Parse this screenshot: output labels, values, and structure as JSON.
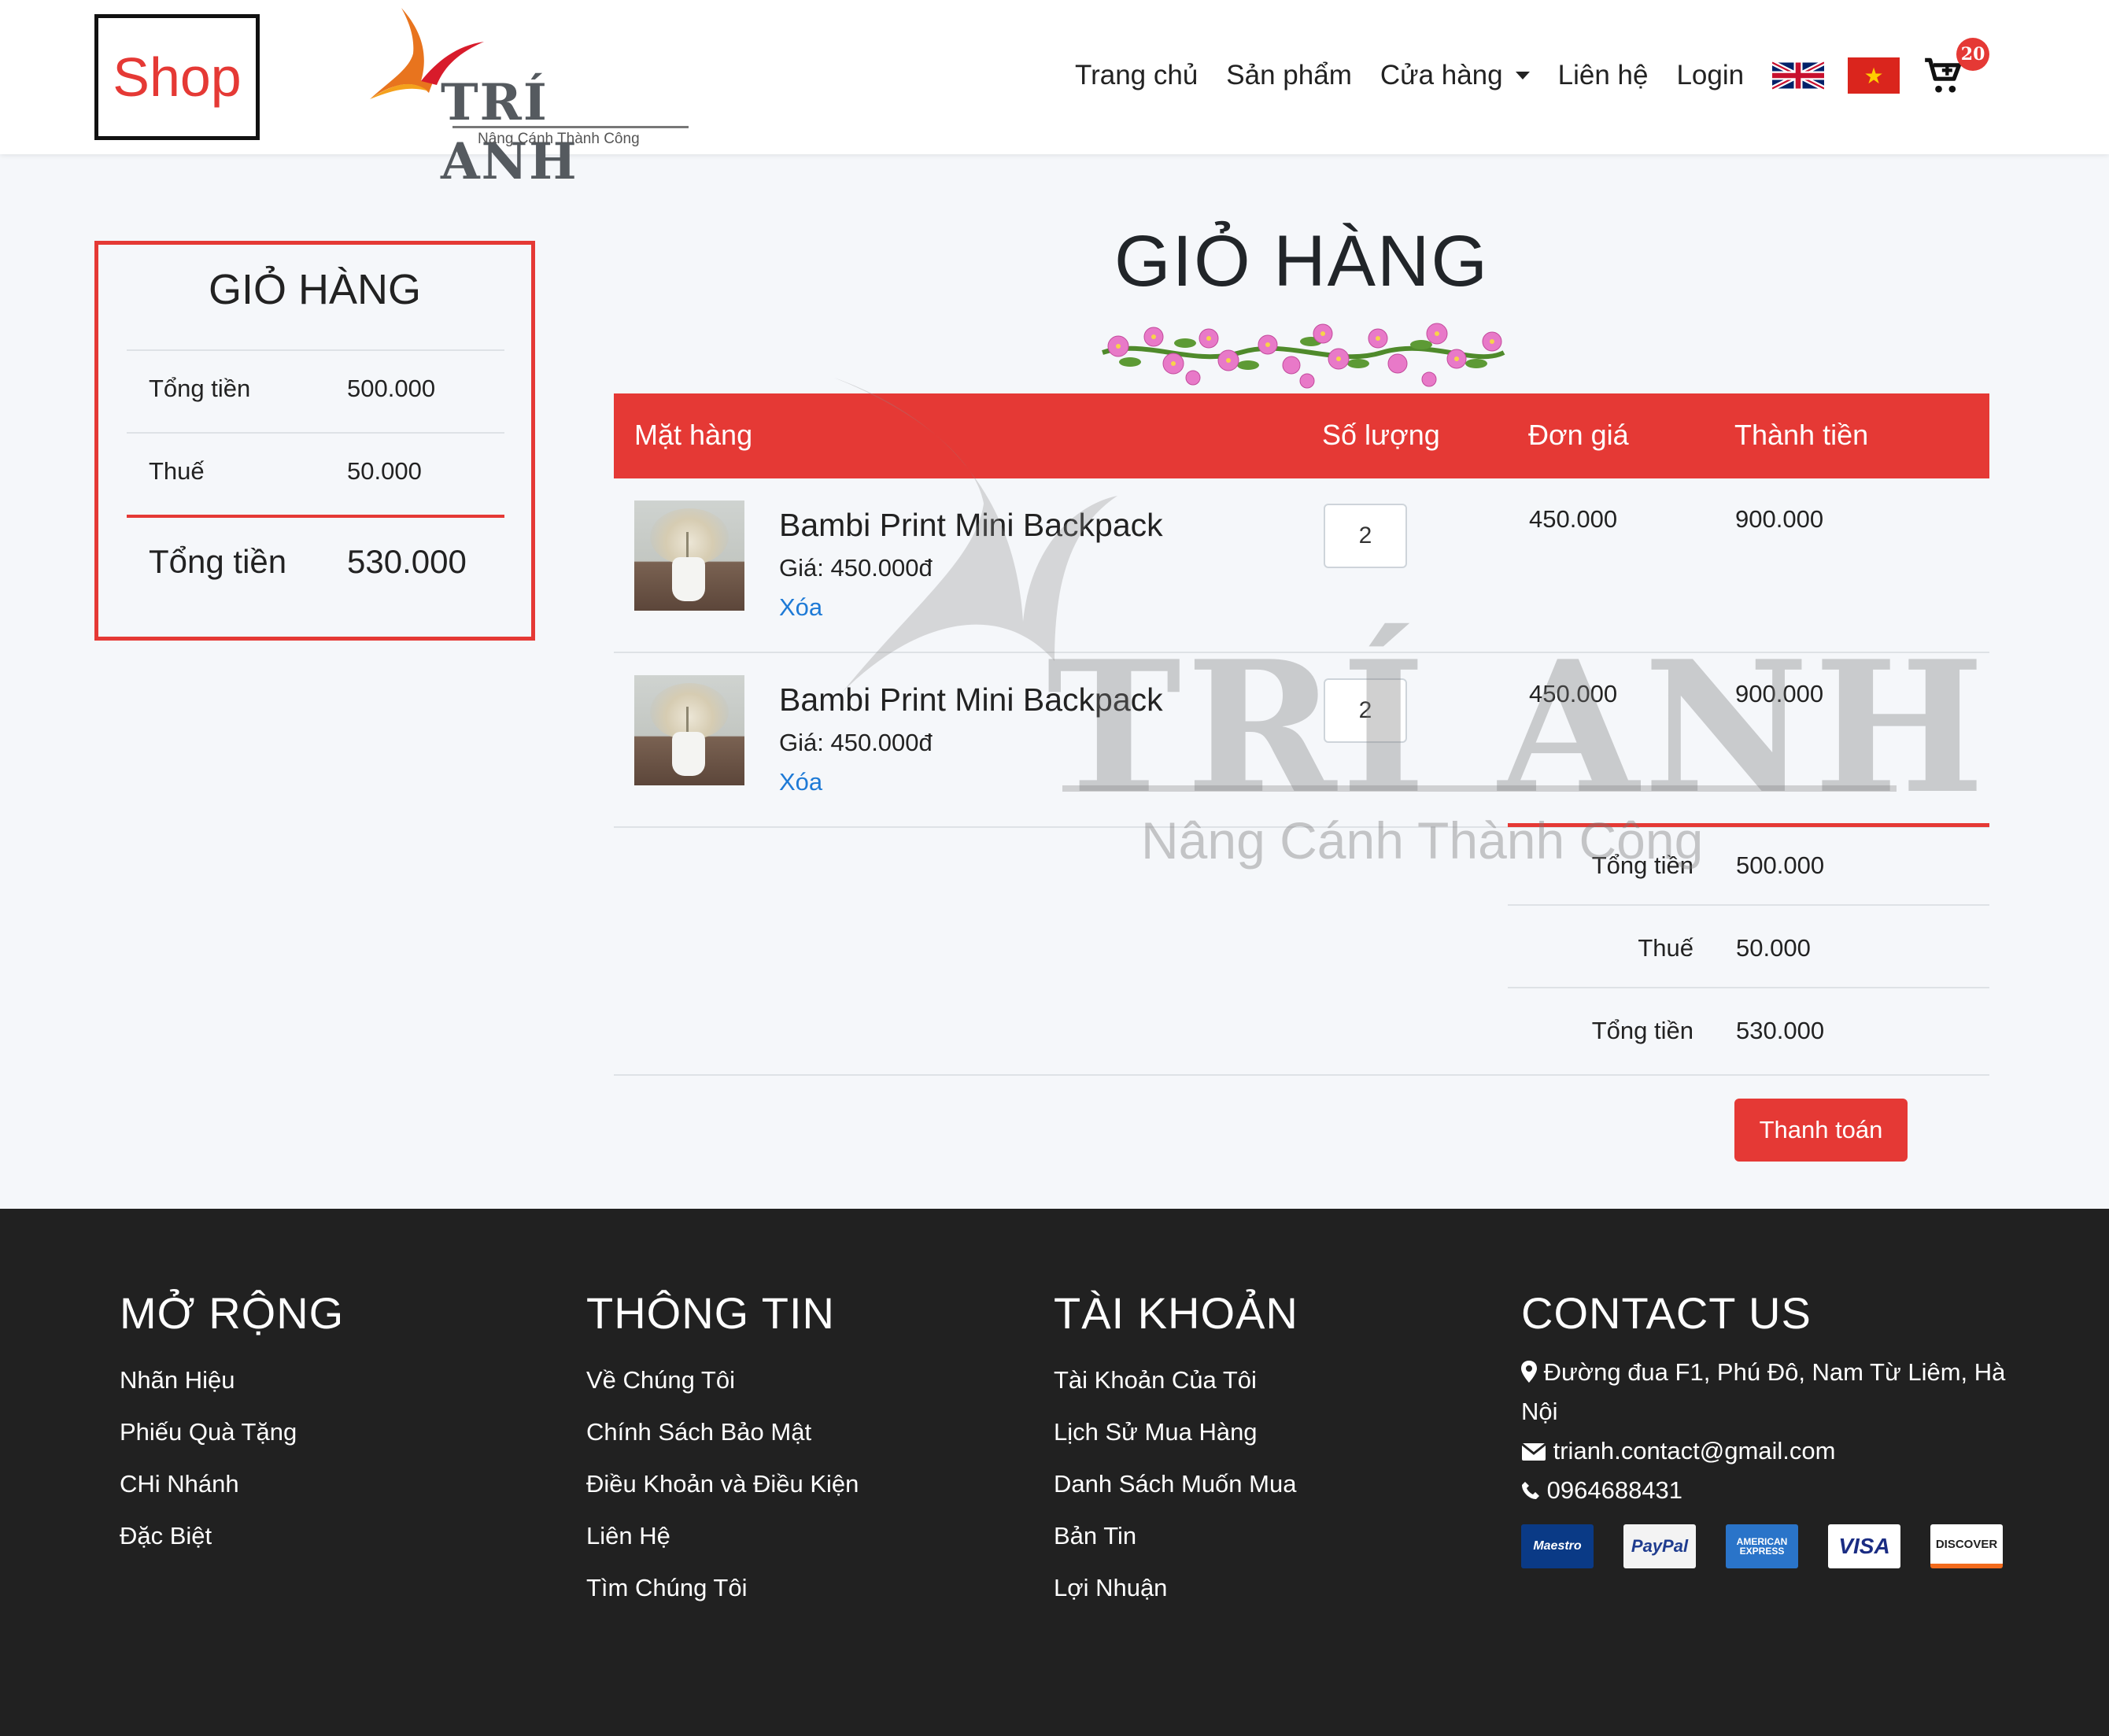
{
  "header": {
    "shop_logo": "Shop",
    "brand_name": "TRÍ ANH",
    "brand_tagline": "Nâng Cánh Thành Công",
    "nav": [
      "Trang chủ",
      "Sản phẩm",
      "Cửa hàng",
      "Liên hệ",
      "Login"
    ],
    "cart_count": "20"
  },
  "sidebar": {
    "title": "GIỎ HÀNG",
    "rows": [
      {
        "label": "Tổng tiền",
        "value": "500.000"
      },
      {
        "label": "Thuế",
        "value": "50.000"
      }
    ],
    "total": {
      "label": "Tổng tiền",
      "value": "530.000"
    }
  },
  "main": {
    "title": "GIỎ HÀNG",
    "columns": [
      "Mặt hàng",
      "Số lượng",
      "Đơn giá",
      "Thành tiền"
    ],
    "items": [
      {
        "name": "Bambi Print Mini Backpack",
        "price": "Giá: 450.000đ",
        "remove": "Xóa",
        "qty": "2",
        "unit_price": "450.000",
        "line_total": "900.000"
      },
      {
        "name": "Bambi Print Mini Backpack",
        "price": "Giá: 450.000đ",
        "remove": "Xóa",
        "qty": "2",
        "unit_price": "450.000",
        "line_total": "900.000"
      }
    ],
    "totals": [
      {
        "label": "Tổng tiền",
        "value": "500.000"
      },
      {
        "label": "Thuế",
        "value": "50.000"
      },
      {
        "label": "Tổng tiền",
        "value": "530.000"
      }
    ],
    "checkout": "Thanh toán"
  },
  "watermark": {
    "name": "TRÍ ANH",
    "tagline": "Nâng Cánh Thành Công"
  },
  "footer": {
    "col1": {
      "title": "MỞ RỘNG",
      "links": [
        "Nhãn Hiệu",
        "Phiếu Quà Tặng",
        "CHi Nhánh",
        "Đặc Biệt"
      ]
    },
    "col2": {
      "title": "THÔNG TIN",
      "links": [
        "Về Chúng Tôi",
        "Chính Sách Bảo Mật",
        "Điều Khoản và Điều Kiện",
        "Liên Hệ",
        "Tìm Chúng Tôi"
      ]
    },
    "col3": {
      "title": "TÀI KHOẢN",
      "links": [
        "Tài Khoản Của Tôi",
        "Lịch Sử Mua Hàng",
        "Danh Sách Muốn Mua",
        "Bản Tin",
        "Lợi Nhuận"
      ]
    },
    "contact": {
      "title": "CONTACT US",
      "address": "Đường đua F1, Phú Đô, Nam Từ Liêm, Hà Nội",
      "email": "trianh.contact@gmail.com",
      "phone": "0964688431",
      "cards": [
        "Maestro",
        "PayPal",
        "AMERICAN EXPRESS",
        "VISA",
        "DISCOVER"
      ]
    }
  },
  "colors": {
    "accent": "#e53935",
    "footer_bg": "#212121",
    "link": "#1e7ad6"
  }
}
